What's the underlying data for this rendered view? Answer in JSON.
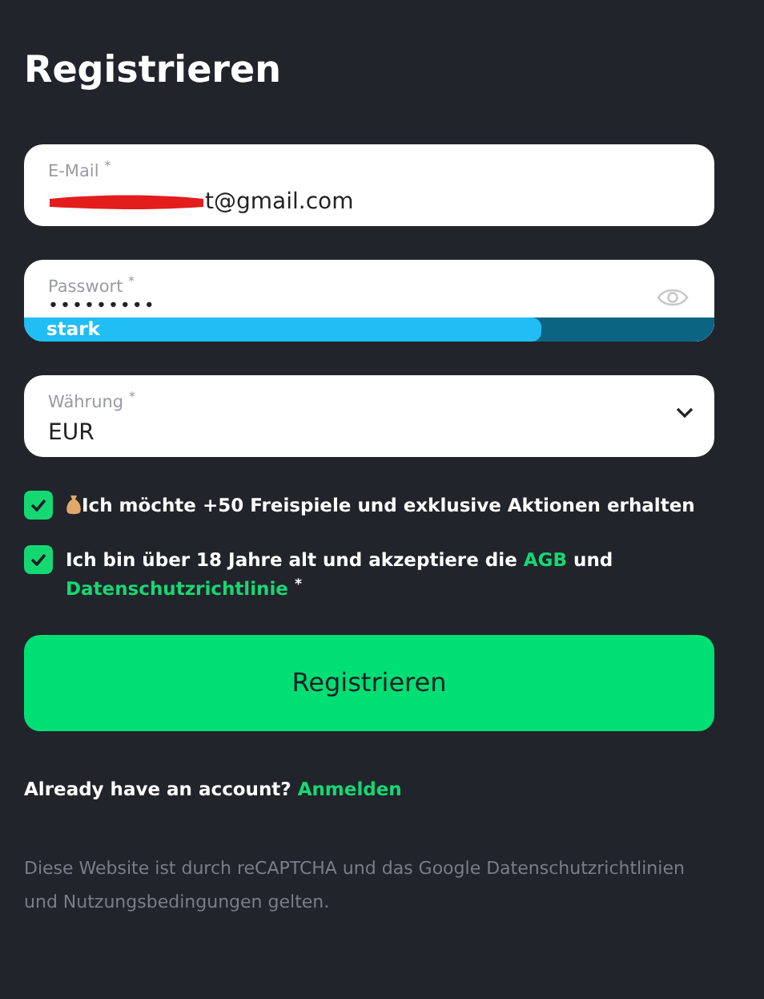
{
  "title": "Registrieren",
  "email": {
    "label": "E-Mail",
    "required_mark": "*",
    "value": "t@gmail.com",
    "redacted": true
  },
  "password": {
    "label": "Passwort",
    "required_mark": "*",
    "value": "•••••••••",
    "strength": {
      "label": "stark",
      "level": 0.75
    }
  },
  "currency": {
    "label": "Währung",
    "required_mark": "*",
    "value": "EUR"
  },
  "checkboxes": [
    {
      "checked": true,
      "icon": true,
      "text": "Ich möchte +50 Freispiele und exklusive Aktionen erhalten"
    },
    {
      "checked": true,
      "icon": false,
      "parts": [
        {
          "kind": "text",
          "text": "Ich bin über 18 Jahre alt und akzeptiere die"
        },
        {
          "kind": "link",
          "text": "AGB"
        },
        {
          "kind": "text",
          "text": "und"
        },
        {
          "kind": "link",
          "text": "Datenschutzrichtlinie"
        },
        {
          "kind": "mark",
          "text": "*"
        }
      ]
    }
  ],
  "submit": "Registrieren",
  "login_prompt": {
    "text": "Already have an account?",
    "link": "Anmelden"
  },
  "footer": "Diese Website ist durch reCAPTCHA und das Google Datenschutzrichtlinien und Nutzungsbedingungen gelten."
}
